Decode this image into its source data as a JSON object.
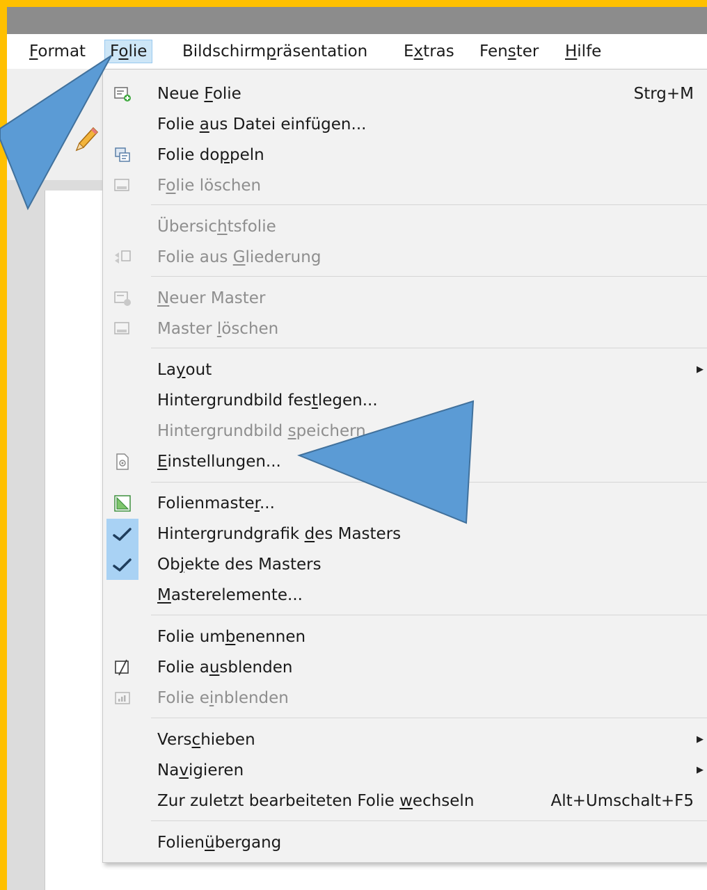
{
  "menubar": {
    "items": [
      {
        "pre": "",
        "u": "F",
        "post": "ormat"
      },
      {
        "pre": "F",
        "u": "o",
        "post": "lie"
      },
      {
        "pre": "Bildschirm",
        "u": "p",
        "post": "räsentation"
      },
      {
        "pre": "E",
        "u": "x",
        "post": "tras"
      },
      {
        "pre": "Fen",
        "u": "s",
        "post": "ter"
      },
      {
        "pre": "",
        "u": "H",
        "post": "ilfe"
      }
    ]
  },
  "menu": {
    "items": [
      {
        "pre": "Neue ",
        "u": "F",
        "post": "olie",
        "shortcut": "Strg+M"
      },
      {
        "pre": "Folie ",
        "u": "a",
        "post": "us Datei einfügen..."
      },
      {
        "pre": "Folie do",
        "u": "p",
        "post": "peln"
      },
      {
        "pre": "F",
        "u": "o",
        "post": "lie löschen"
      },
      {
        "pre": "Übersic",
        "u": "h",
        "post": "tsfolie"
      },
      {
        "pre": "Folie aus ",
        "u": "G",
        "post": "liederung"
      },
      {
        "pre": "",
        "u": "N",
        "post": "euer Master"
      },
      {
        "pre": "Master ",
        "u": "l",
        "post": "öschen"
      },
      {
        "pre": "La",
        "u": "y",
        "post": "out"
      },
      {
        "pre": "Hintergrundbild fes",
        "u": "t",
        "post": "legen..."
      },
      {
        "pre": "Hintergrundbild ",
        "u": "s",
        "post": "peichern..."
      },
      {
        "pre": "",
        "u": "E",
        "post": "instellungen..."
      },
      {
        "pre": "Folienmaste",
        "u": "r",
        "post": "..."
      },
      {
        "pre": "Hintergrundgrafik ",
        "u": "d",
        "post": "es Masters"
      },
      {
        "pre": "Ob",
        "u": "j",
        "post": "ekte des Masters"
      },
      {
        "pre": "",
        "u": "M",
        "post": "asterelemente..."
      },
      {
        "pre": "Folie um",
        "u": "b",
        "post": "enennen"
      },
      {
        "pre": "Folie a",
        "u": "u",
        "post": "sblenden"
      },
      {
        "pre": "Folie e",
        "u": "i",
        "post": "nblenden"
      },
      {
        "pre": "Vers",
        "u": "c",
        "post": "hieben"
      },
      {
        "pre": "Na",
        "u": "v",
        "post": "igieren"
      },
      {
        "pre": "Zur zuletzt bearbeiteten Folie ",
        "u": "w",
        "post": "echseln",
        "shortcut": "Alt+Umschalt+F5"
      },
      {
        "pre": "Folien",
        "u": "ü",
        "post": "bergang"
      }
    ]
  },
  "colors": {
    "frame_border": "#ffc000",
    "titlebar": "#8c8c8c",
    "active_menu_bg": "#cde6f7",
    "check_bg": "#a9d2f4",
    "arrow_fill": "#5b9bd5",
    "disabled_text": "#8e8e8e"
  }
}
